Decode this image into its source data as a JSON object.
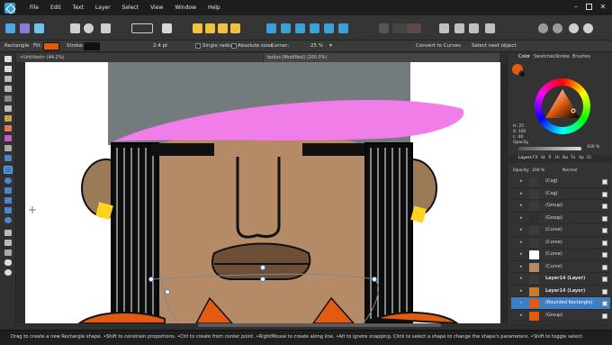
{
  "menubar": {
    "items": [
      "File",
      "Edit",
      "Text",
      "Layer",
      "Select",
      "View",
      "Window",
      "Help"
    ],
    "window_controls": [
      "minimize-icon",
      "maximize-icon",
      "close-icon"
    ]
  },
  "context_toolbar": {
    "tool_name": "Rectangle",
    "fill_label": "Fill:",
    "fill_color": "#e35b10",
    "stroke_label": "Stroke:",
    "stroke_color": "#111111",
    "stroke_width": "2.4 pt",
    "single_radius": "Single radius",
    "absolute_sizes": "Absolute sizes",
    "corner_label": "Corner:",
    "corner_value": "25 %",
    "convert_label": "Convert to Curves",
    "select_next": "Select next object"
  },
  "tabs": [
    {
      "label": "<Untitled> (44.2%)"
    },
    {
      "label": "bodys [Modified] (200.0%)"
    }
  ],
  "right_panel": {
    "top_tabs": [
      "Color",
      "Swatches",
      "Stroke",
      "Brushes"
    ],
    "hsl": {
      "h": "H: 25",
      "s": "S: 100",
      "l": "L: 40"
    },
    "opacity_label": "Opacity",
    "opacity_value": "100 %",
    "layer_tabs": [
      "Layers",
      "FX",
      "St",
      "Tr",
      "Hi",
      "Na",
      "Tx",
      "Ap",
      "Gl"
    ],
    "layer_opacity_label": "Opacity:",
    "layer_opacity_value": "100 %",
    "blend_mode": "Normal",
    "layers": [
      {
        "name": "(Cog)",
        "selected": false,
        "bold": false,
        "thumb": "#3a3a3a"
      },
      {
        "name": "(Cog)",
        "selected": false,
        "bold": false,
        "thumb": "#3a3a3a"
      },
      {
        "name": "(Group)",
        "selected": false,
        "bold": false,
        "thumb": "#3a3a3a"
      },
      {
        "name": "(Group)",
        "selected": false,
        "bold": false,
        "thumb": "#2e2e2e"
      },
      {
        "name": "(Curve)",
        "selected": false,
        "bold": false,
        "thumb": "#3a3a3a"
      },
      {
        "name": "(Curve)",
        "selected": false,
        "bold": false,
        "thumb": "#3a3a3a"
      },
      {
        "name": "(Curve)",
        "selected": false,
        "bold": false,
        "thumb": "#ffffff"
      },
      {
        "name": "(Curve)",
        "selected": false,
        "bold": false,
        "thumb": "#b58a67"
      },
      {
        "name": "Layer14 (Layer)",
        "selected": false,
        "bold": true,
        "thumb": "#3a3a3a"
      },
      {
        "name": "Layer14 (Layer)",
        "selected": false,
        "bold": true,
        "thumb": "#c77b30"
      },
      {
        "name": "(Rounded Rectangle)",
        "selected": true,
        "bold": false,
        "thumb": "#e35b10"
      },
      {
        "name": "(Group)",
        "selected": false,
        "bold": false,
        "thumb": "#e35b10"
      }
    ]
  },
  "status_bar": {
    "text": "Drag to create a new Rectangle shape. •Shift to constrain proportions. •Ctrl to create from center point. •RightMouse to create along line. •Alt to ignore snapping. Click to select a shape to change the shape's parameters. •Shift to toggle select."
  },
  "colors": {
    "hat": "#737b7d",
    "visor": "#f07de8",
    "skin": "#b58a67",
    "hair": "#0d0d0d",
    "shirt": "#e35b10",
    "earring": "#ffd21e",
    "accent": "#3c7fc4"
  }
}
